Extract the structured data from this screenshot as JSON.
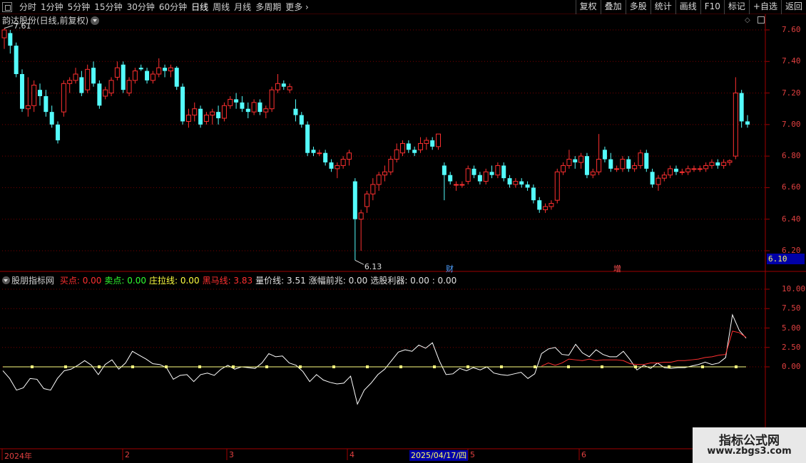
{
  "toolbar": {
    "periods": [
      "分时",
      "1分钟",
      "5分钟",
      "15分钟",
      "30分钟",
      "60分钟",
      "日线",
      "周线",
      "月线",
      "多周期",
      "更多"
    ],
    "active_period": "日线",
    "buttons": [
      "复权",
      "叠加",
      "多股",
      "统计",
      "画线",
      "F10",
      "标记",
      "+自选",
      "返回"
    ]
  },
  "main_chart": {
    "title": "韵达股份(日线,前复权)",
    "price_axis": [
      "7.60",
      "7.40",
      "7.20",
      "7.00",
      "6.80",
      "6.60",
      "6.40",
      "6.20"
    ],
    "current_price": "6.10",
    "high_label": "7.61",
    "low_label": "6.13",
    "events": [
      {
        "label": "财",
        "color": "#4fa0ff"
      },
      {
        "label": "增",
        "color": "#ff5050"
      }
    ]
  },
  "indicator": {
    "name": "股朋指标网",
    "items": [
      {
        "label": "买点: 0.00",
        "color": "#ff3030"
      },
      {
        "label": "卖点: 0.00",
        "color": "#30ff30"
      },
      {
        "label": "庄拉线: 0.00",
        "color": "#ffff40"
      },
      {
        "label": "黑马线: 3.83",
        "color": "#ff3030"
      },
      {
        "label": "量价线: 3.51",
        "color": "#e0e0e0"
      },
      {
        "label": "涨幅前兆: 0.00",
        "color": "#e0e0e0"
      },
      {
        "label": "选股利器: 0.00 : 0.00",
        "color": "#e0e0e0"
      }
    ],
    "axis": [
      "10.00",
      "7.50",
      "5.00",
      "2.50",
      "0.00"
    ]
  },
  "date_axis": {
    "labels": [
      "2024年",
      "2",
      "3",
      "4",
      "5",
      "6"
    ],
    "cursor_date": "2025/04/17/四"
  },
  "watermark": {
    "line1": "指标公式网",
    "line2": "www.zbgs3.com"
  },
  "colors": {
    "up": "#ff3030",
    "down": "#54fcfc",
    "grid": "#7a0000",
    "white_line": "#ffffff",
    "yellow_line": "#ffff80"
  },
  "chart_data": {
    "type": "candlestick",
    "ylim": [
      6.1,
      7.65
    ],
    "candles": [
      [
        7.55,
        7.61,
        7.48,
        7.6
      ],
      [
        7.58,
        7.6,
        7.45,
        7.5
      ],
      [
        7.5,
        7.52,
        7.3,
        7.32
      ],
      [
        7.32,
        7.35,
        7.08,
        7.1
      ],
      [
        7.1,
        7.3,
        7.05,
        7.12
      ],
      [
        7.12,
        7.28,
        7.08,
        7.25
      ],
      [
        7.22,
        7.26,
        7.12,
        7.18
      ],
      [
        7.18,
        7.22,
        7.05,
        7.08
      ],
      [
        7.08,
        7.12,
        6.98,
        7.0
      ],
      [
        7.0,
        7.02,
        6.88,
        6.9
      ],
      [
        7.08,
        7.28,
        7.05,
        7.26
      ],
      [
        7.26,
        7.3,
        7.2,
        7.28
      ],
      [
        7.28,
        7.36,
        7.26,
        7.32
      ],
      [
        7.3,
        7.34,
        7.18,
        7.2
      ],
      [
        7.22,
        7.38,
        7.2,
        7.35
      ],
      [
        7.36,
        7.4,
        7.24,
        7.26
      ],
      [
        7.26,
        7.28,
        7.1,
        7.12
      ],
      [
        7.18,
        7.24,
        7.16,
        7.22
      ],
      [
        7.2,
        7.3,
        7.18,
        7.28
      ],
      [
        7.3,
        7.4,
        7.28,
        7.36
      ],
      [
        7.38,
        7.4,
        7.2,
        7.22
      ],
      [
        7.2,
        7.3,
        7.18,
        7.28
      ],
      [
        7.28,
        7.36,
        7.26,
        7.34
      ],
      [
        7.36,
        7.38,
        7.34,
        7.35
      ],
      [
        7.34,
        7.36,
        7.26,
        7.28
      ],
      [
        7.28,
        7.34,
        7.26,
        7.32
      ],
      [
        7.32,
        7.42,
        7.3,
        7.36
      ],
      [
        7.36,
        7.38,
        7.3,
        7.34
      ],
      [
        7.34,
        7.38,
        7.3,
        7.36
      ],
      [
        7.36,
        7.37,
        7.22,
        7.24
      ],
      [
        7.24,
        7.26,
        7.0,
        7.02
      ],
      [
        7.02,
        7.1,
        6.98,
        7.06
      ],
      [
        7.06,
        7.14,
        7.02,
        7.1
      ],
      [
        7.1,
        7.12,
        6.98,
        7.0
      ],
      [
        7.02,
        7.08,
        7.0,
        7.06
      ],
      [
        7.06,
        7.1,
        7.0,
        7.08
      ],
      [
        7.08,
        7.12,
        7.0,
        7.04
      ],
      [
        7.04,
        7.14,
        7.02,
        7.12
      ],
      [
        7.12,
        7.18,
        7.1,
        7.16
      ],
      [
        7.16,
        7.2,
        7.1,
        7.14
      ],
      [
        7.14,
        7.18,
        7.08,
        7.1
      ],
      [
        7.1,
        7.14,
        7.04,
        7.08
      ],
      [
        7.08,
        7.16,
        7.06,
        7.14
      ],
      [
        7.14,
        7.16,
        7.06,
        7.08
      ],
      [
        7.08,
        7.12,
        7.04,
        7.1
      ],
      [
        7.1,
        7.24,
        7.08,
        7.22
      ],
      [
        7.22,
        7.32,
        7.2,
        7.26
      ],
      [
        7.26,
        7.28,
        7.22,
        7.24
      ],
      [
        7.22,
        7.26,
        7.2,
        7.24
      ],
      [
        7.1,
        7.16,
        7.02,
        7.06
      ],
      [
        7.06,
        7.08,
        6.98,
        7.0
      ],
      [
        7.0,
        7.02,
        6.8,
        6.82
      ],
      [
        6.84,
        6.86,
        6.8,
        6.82
      ],
      [
        6.82,
        6.84,
        6.8,
        6.82
      ],
      [
        6.82,
        6.84,
        6.74,
        6.76
      ],
      [
        6.76,
        6.78,
        6.7,
        6.72
      ],
      [
        6.72,
        6.76,
        6.66,
        6.74
      ],
      [
        6.74,
        6.8,
        6.72,
        6.78
      ],
      [
        6.78,
        6.84,
        6.74,
        6.82
      ],
      [
        6.64,
        6.66,
        6.14,
        6.4
      ],
      [
        6.4,
        6.46,
        6.2,
        6.44
      ],
      [
        6.48,
        6.58,
        6.44,
        6.56
      ],
      [
        6.56,
        6.66,
        6.52,
        6.62
      ],
      [
        6.62,
        6.7,
        6.58,
        6.68
      ],
      [
        6.68,
        6.74,
        6.64,
        6.7
      ],
      [
        6.7,
        6.8,
        6.68,
        6.78
      ],
      [
        6.78,
        6.88,
        6.76,
        6.84
      ],
      [
        6.82,
        6.9,
        6.8,
        6.88
      ],
      [
        6.88,
        6.9,
        6.82,
        6.84
      ],
      [
        6.84,
        6.86,
        6.8,
        6.82
      ],
      [
        6.84,
        6.92,
        6.82,
        6.88
      ],
      [
        6.88,
        6.92,
        6.84,
        6.9
      ],
      [
        6.9,
        6.92,
        6.84,
        6.86
      ],
      [
        6.86,
        6.94,
        6.84,
        6.94
      ],
      [
        6.74,
        6.76,
        6.52,
        6.68
      ],
      [
        6.68,
        6.7,
        6.62,
        6.64
      ],
      [
        6.62,
        6.64,
        6.58,
        6.62
      ],
      [
        6.62,
        6.64,
        6.6,
        6.62
      ],
      [
        6.64,
        6.74,
        6.62,
        6.72
      ],
      [
        6.72,
        6.74,
        6.66,
        6.68
      ],
      [
        6.68,
        6.7,
        6.62,
        6.64
      ],
      [
        6.64,
        6.72,
        6.62,
        6.7
      ],
      [
        6.7,
        6.74,
        6.66,
        6.68
      ],
      [
        6.68,
        6.76,
        6.66,
        6.74
      ],
      [
        6.74,
        6.76,
        6.64,
        6.66
      ],
      [
        6.66,
        6.68,
        6.6,
        6.62
      ],
      [
        6.62,
        6.66,
        6.6,
        6.64
      ],
      [
        6.64,
        6.66,
        6.6,
        6.62
      ],
      [
        6.62,
        6.64,
        6.58,
        6.6
      ],
      [
        6.6,
        6.62,
        6.5,
        6.52
      ],
      [
        6.52,
        6.54,
        6.44,
        6.46
      ],
      [
        6.46,
        6.5,
        6.44,
        6.48
      ],
      [
        6.48,
        6.52,
        6.46,
        6.5
      ],
      [
        6.52,
        6.72,
        6.5,
        6.7
      ],
      [
        6.7,
        6.76,
        6.68,
        6.74
      ],
      [
        6.74,
        6.84,
        6.72,
        6.78
      ],
      [
        6.78,
        6.8,
        6.72,
        6.76
      ],
      [
        6.76,
        6.82,
        6.72,
        6.8
      ],
      [
        6.8,
        6.82,
        6.66,
        6.68
      ],
      [
        6.68,
        6.72,
        6.66,
        6.7
      ],
      [
        6.7,
        6.94,
        6.68,
        6.78
      ],
      [
        6.84,
        6.86,
        6.76,
        6.78
      ],
      [
        6.78,
        6.82,
        6.7,
        6.72
      ],
      [
        6.72,
        6.74,
        6.7,
        6.72
      ],
      [
        6.72,
        6.8,
        6.7,
        6.78
      ],
      [
        6.78,
        6.8,
        6.7,
        6.72
      ],
      [
        6.72,
        6.76,
        6.7,
        6.74
      ],
      [
        6.74,
        6.84,
        6.72,
        6.82
      ],
      [
        6.82,
        6.84,
        6.7,
        6.72
      ],
      [
        6.7,
        6.72,
        6.6,
        6.62
      ],
      [
        6.62,
        6.68,
        6.58,
        6.66
      ],
      [
        6.66,
        6.7,
        6.64,
        6.68
      ],
      [
        6.68,
        6.74,
        6.66,
        6.72
      ],
      [
        6.72,
        6.74,
        6.68,
        6.7
      ],
      [
        6.7,
        6.72,
        6.68,
        6.7
      ],
      [
        6.7,
        6.74,
        6.68,
        6.72
      ],
      [
        6.72,
        6.74,
        6.7,
        6.72
      ],
      [
        6.72,
        6.74,
        6.7,
        6.72
      ],
      [
        6.72,
        6.76,
        6.7,
        6.74
      ],
      [
        6.74,
        6.78,
        6.72,
        6.76
      ],
      [
        6.76,
        6.78,
        6.72,
        6.74
      ],
      [
        6.74,
        6.78,
        6.72,
        6.76
      ],
      [
        6.76,
        6.78,
        6.74,
        6.77
      ],
      [
        6.8,
        7.3,
        6.78,
        7.2
      ],
      [
        7.2,
        7.22,
        6.98,
        7.02
      ],
      [
        7.02,
        7.06,
        6.98,
        7.0
      ]
    ],
    "white_line_values": [
      -0.5,
      -1.5,
      -3.0,
      -2.7,
      -1.5,
      -1.6,
      -2.8,
      -3.0,
      -1.5,
      -0.5,
      -0.3,
      0.2,
      0.8,
      0.2,
      -1.0,
      0.3,
      0.9,
      -0.3,
      0.5,
      2.0,
      1.5,
      1.0,
      0.4,
      0.3,
      -0.1,
      -1.6,
      -1.1,
      -1.0,
      -1.9,
      -1.0,
      -0.8,
      -1.1,
      -0.3,
      0.2,
      -0.3,
      0.0,
      -0.1,
      -0.2,
      0.5,
      1.7,
      1.3,
      1.4,
      0.5,
      0.2,
      -0.6,
      -1.9,
      -1.0,
      -1.7,
      -2.0,
      -2.2,
      -2.1,
      -1.2,
      -4.8,
      -3.0,
      -2.1,
      -1.0,
      -0.3,
      0.8,
      1.9,
      2.2,
      2.0,
      2.8,
      2.4,
      3.1,
      0.8,
      -1.0,
      -0.9,
      -0.2,
      -0.5,
      -0.1,
      -0.4,
      0.0,
      -0.8,
      -1.0,
      -1.1,
      -0.9,
      -0.7,
      -1.5,
      -0.9,
      1.7,
      2.3,
      2.5,
      1.6,
      1.5,
      2.9,
      1.8,
      1.3,
      2.2,
      1.6,
      1.3,
      1.3,
      2.0,
      0.9,
      -0.4,
      0.2,
      -0.2,
      0.5,
      -0.1,
      -0.2,
      -0.1,
      -0.1,
      0.1,
      0.3,
      0.6,
      0.3,
      0.5,
      1.2,
      6.7,
      4.7,
      3.7
    ],
    "red_line_values": [
      0.1,
      0.5,
      0.2,
      0.5,
      1.0,
      0.9,
      0.8,
      1.0,
      0.8,
      0.9,
      0.9,
      0.9,
      0.8,
      0.4,
      0.3,
      0.3,
      0.5,
      0.5,
      0.6,
      0.6,
      0.8,
      0.8,
      0.9,
      1.0,
      1.2,
      1.3,
      1.5,
      1.6,
      4.6,
      4.4,
      3.8
    ],
    "red_start_index": 79,
    "yellow_line_value": 0.0
  }
}
